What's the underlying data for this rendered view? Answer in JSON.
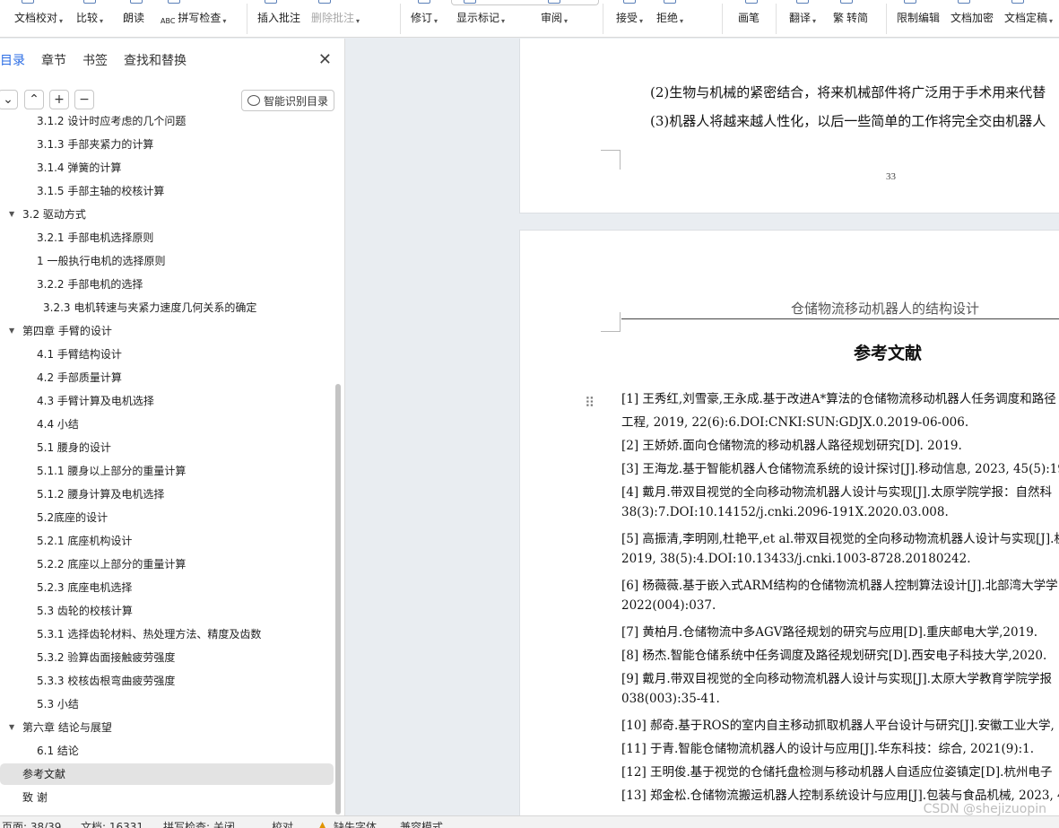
{
  "ribbon": {
    "items": [
      {
        "label": "文档校对",
        "caret": "▾",
        "disabled": false,
        "icon": "proofread-icon"
      },
      {
        "label": "比较",
        "caret": "▾",
        "disabled": false,
        "icon": "compare-icon"
      },
      {
        "label": "朗读",
        "caret": "",
        "disabled": false,
        "icon": "read-aloud-icon"
      },
      {
        "label": "拼写检查",
        "prefix": "ABC",
        "caret": "▾",
        "disabled": false,
        "icon": "spellcheck-icon"
      },
      {
        "label": "插入批注",
        "caret": "",
        "disabled": false,
        "icon": "insert-comment-icon"
      },
      {
        "label": "删除批注",
        "caret": "▾",
        "disabled": true,
        "icon": "delete-comment-icon"
      },
      {
        "label": "修订",
        "caret": "▾",
        "disabled": false,
        "icon": "track-changes-icon"
      },
      {
        "label": "显示标记",
        "caret": "▾",
        "disabled": false,
        "icon": "show-markup-icon"
      },
      {
        "label": "审阅",
        "caret": "▾",
        "disabled": false,
        "icon": "review-pane-icon"
      },
      {
        "label": "接受",
        "caret": "▾",
        "disabled": false,
        "icon": "accept-icon"
      },
      {
        "label": "拒绝",
        "caret": "▾",
        "disabled": false,
        "icon": "reject-icon"
      },
      {
        "label": "画笔",
        "caret": "",
        "disabled": false,
        "icon": "pen-icon"
      },
      {
        "label": "翻译",
        "caret": "▾",
        "disabled": false,
        "icon": "translate-icon"
      },
      {
        "label": "转简",
        "prefix": "繁",
        "caret": "",
        "disabled": false,
        "icon": "convert-simplified-icon"
      },
      {
        "label": "限制编辑",
        "caret": "",
        "disabled": false,
        "icon": "restrict-edit-icon"
      },
      {
        "label": "文档加密",
        "caret": "",
        "disabled": false,
        "icon": "encrypt-icon"
      },
      {
        "label": "文档定稿",
        "caret": "▾",
        "disabled": false,
        "icon": "finalize-icon"
      }
    ]
  },
  "nav": {
    "tabs": [
      {
        "label": "目录",
        "active": true
      },
      {
        "label": "章节",
        "active": false
      },
      {
        "label": "书签",
        "active": false
      },
      {
        "label": "查找和替换",
        "active": false
      }
    ],
    "close": "✕",
    "tools": {
      "collapse_all": "⌄",
      "expand": "⌃",
      "add": "+",
      "remove": "−",
      "smart_label": "智能识别目录"
    },
    "toc": [
      {
        "text": "3.1.2  设计时应考虑的几个问题",
        "level": 3,
        "toggle": ""
      },
      {
        "text": "3.1.3  手部夹紧力的计算",
        "level": 3,
        "toggle": ""
      },
      {
        "text": "3.1.4  弹簧的计算",
        "level": 3,
        "toggle": ""
      },
      {
        "text": "3.1.5  手部主轴的校核计算",
        "level": 3,
        "toggle": ""
      },
      {
        "text": "3.2  驱动方式",
        "level": 2,
        "toggle": "▼"
      },
      {
        "text": "3.2.1  手部电机选择原则",
        "level": 3,
        "toggle": ""
      },
      {
        "text": "1  一般执行电机的选择原则",
        "level": 3,
        "toggle": ""
      },
      {
        "text": "3.2.2  手部电机的选择",
        "level": 3,
        "toggle": ""
      },
      {
        "text": "3.2.3  电机转速与夹紧力速度几何关系的确定",
        "level": 4,
        "toggle": ""
      },
      {
        "text": "第四章    手臂的设计",
        "level": 2,
        "toggle": "▼"
      },
      {
        "text": "4.1  手臂结构设计",
        "level": 3,
        "toggle": ""
      },
      {
        "text": "4.2  手部质量计算",
        "level": 3,
        "toggle": ""
      },
      {
        "text": "4.3  手臂计算及电机选择",
        "level": 3,
        "toggle": ""
      },
      {
        "text": "4.4    小结",
        "level": 3,
        "toggle": ""
      },
      {
        "text": "5.1  腰身的设计",
        "level": 3,
        "toggle": ""
      },
      {
        "text": "5.1.1  腰身以上部分的重量计算",
        "level": 3,
        "toggle": ""
      },
      {
        "text": "5.1.2  腰身计算及电机选择",
        "level": 3,
        "toggle": ""
      },
      {
        "text": "5.2底座的设计",
        "level": 3,
        "toggle": ""
      },
      {
        "text": "5.2.1  底座机构设计",
        "level": 3,
        "toggle": ""
      },
      {
        "text": "5.2.2  底座以上部分的重量计算",
        "level": 3,
        "toggle": ""
      },
      {
        "text": "5.2.3  底座电机选择",
        "level": 3,
        "toggle": ""
      },
      {
        "text": "5.3  齿轮的校核计算",
        "level": 3,
        "toggle": ""
      },
      {
        "text": "5.3.1  选择齿轮材料、热处理方法、精度及齿数",
        "level": 3,
        "toggle": ""
      },
      {
        "text": "5.3.2  验算齿面接触疲劳强度",
        "level": 3,
        "toggle": ""
      },
      {
        "text": "5.3.3  校核齿根弯曲疲劳强度",
        "level": 3,
        "toggle": ""
      },
      {
        "text": "5.3    小结",
        "level": 3,
        "toggle": ""
      },
      {
        "text": "第六章  结论与展望",
        "level": 2,
        "toggle": "▼"
      },
      {
        "text": "6.1  结论",
        "level": 3,
        "toggle": ""
      },
      {
        "text": "参考文献",
        "level": 2,
        "toggle": "",
        "selected": true
      },
      {
        "text": "致  谢",
        "level": 2,
        "toggle": ""
      }
    ]
  },
  "document": {
    "page1": {
      "lines": [
        "(2)生物与机械的紧密结合，将来机械部件将广泛用于手术用来代替",
        "(3)机器人将越来越人性化，以后一些简单的工作将完全交由机器人"
      ],
      "page_number": "33"
    },
    "page2": {
      "running_header": "仓储物流移动机器人的结构设计",
      "title": "参考文献",
      "references": [
        "[1]  王秀红,刘雪豪,王永成.基于改进A*算法的仓储物流移动机器人任务调度和路径",
        "工程, 2019, 22(6):6.DOI:CNKI:SUN:GDJX.0.2019-06-006.",
        "[2]  王娇娇.面向仓储物流的移动机器人路径规划研究[D]. 2019.",
        "[3]  王海龙.基于智能机器人仓储物流系统的设计探讨[J].移动信息, 2023, 45(5):192",
        "[4]  戴月.带双目视觉的全向移动物流机器人设计与实现[J].太原学院学报：自然科",
        "38(3):7.DOI:10.14152/j.cnki.2096-191X.2020.03.008.",
        "[5]  高振清,李明刚,杜艳平,et al.带双目视觉的全向移动物流机器人设计与实现[J].机",
        "2019, 38(5):4.DOI:10.13433/j.cnki.1003-8728.20180242.",
        "[6]  杨薇薇.基于嵌入式ARM结构的仓储物流机器人控制算法设计[J].北部湾大学学",
        "2022(004):037.",
        "[7]  黄柏月.仓储物流中多AGV路径规划的研究与应用[D].重庆邮电大学,2019.",
        "[8]  杨杰.智能仓储系统中任务调度及路径规划研究[D].西安电子科技大学,2020.",
        "[9]  戴月.带双目视觉的全向移动物流机器人设计与实现[J].太原大学教育学院学报",
        "038(003):35-41.",
        "[10]  郝奇.基于ROS的室内自主移动抓取机器人平台设计与研究[J].安徽工业大学,",
        "[11]  于青.智能仓储物流机器人的设计与应用[J].华东科技：综合, 2021(9):1.",
        "[12]  王明俊.基于视觉的仓储托盘检测与移动机器人自适应位姿镇定[D].杭州电子",
        "[13]  郑金松.仓储物流搬运机器人控制系统设计与应用[J].包装与食品机械, 2023, 4"
      ]
    }
  },
  "status": {
    "page": "页面: 38/39",
    "words": "文档: 16331",
    "spell": "拼写检查: 关闭",
    "proof": "校对",
    "missing_font": "缺失字体",
    "compat": "兼容模式"
  },
  "watermark": "CSDN @shejizuopin",
  "colors": {
    "accent": "#2b6de5",
    "selected_bg": "#e3e3e3",
    "canvas": "#e9edf1"
  }
}
